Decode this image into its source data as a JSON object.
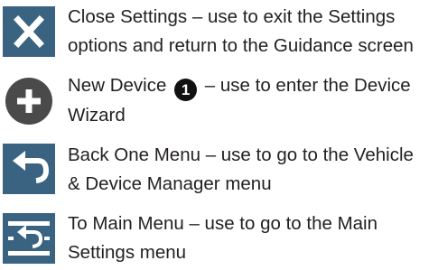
{
  "legend": {
    "items": [
      {
        "icon": "close-icon",
        "lines": [
          "Close Settings – use to exit the Settings",
          "options and return to the Guidance screen"
        ]
      },
      {
        "icon": "add-icon",
        "line1_before": "New Device",
        "badge": "1",
        "line1_after": "– use to enter the Device",
        "line2": "Wizard"
      },
      {
        "icon": "back-icon",
        "lines": [
          "Back One Menu – use to go to the Vehicle",
          "& Device Manager menu"
        ]
      },
      {
        "icon": "main-menu-icon",
        "lines": [
          "To Main Menu – use to go to the Main",
          "Settings menu"
        ]
      }
    ],
    "colors": {
      "icon_blue": "#3a6382",
      "icon_gray": "#4a4a4a",
      "text": "#231f20"
    }
  }
}
